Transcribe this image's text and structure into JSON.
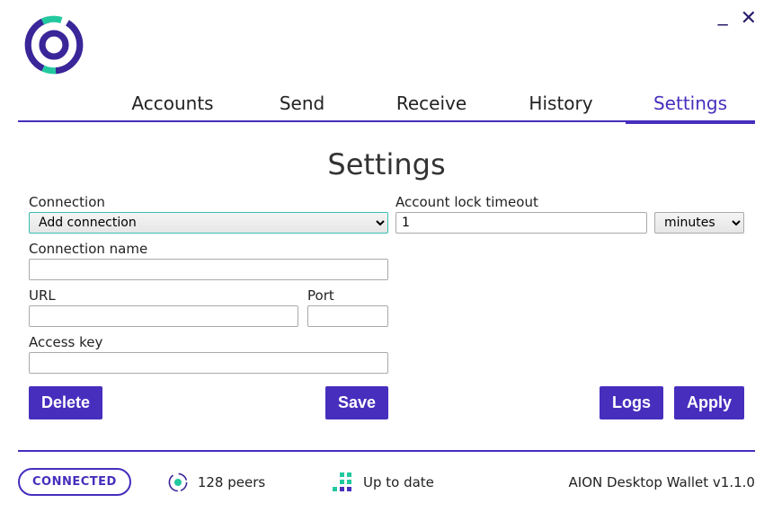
{
  "window": {
    "minimize": "_",
    "close": "✕"
  },
  "tabs": {
    "accounts": "Accounts",
    "send": "Send",
    "receive": "Receive",
    "history": "History",
    "settings": "Settings"
  },
  "page": {
    "title": "Settings"
  },
  "connection": {
    "label": "Connection",
    "selected": "Add connection",
    "name_label": "Connection name",
    "name_value": "",
    "url_label": "URL",
    "url_value": "",
    "port_label": "Port",
    "port_value": "",
    "access_key_label": "Access key",
    "access_key_value": ""
  },
  "timeout": {
    "label": "Account lock timeout",
    "value": "1",
    "unit_selected": "minutes"
  },
  "buttons": {
    "delete": "Delete",
    "save": "Save",
    "logs": "Logs",
    "apply": "Apply"
  },
  "footer": {
    "status": "CONNECTED",
    "peers": "128 peers",
    "update": "Up to date",
    "version": "AION Desktop Wallet v1.1.0"
  }
}
